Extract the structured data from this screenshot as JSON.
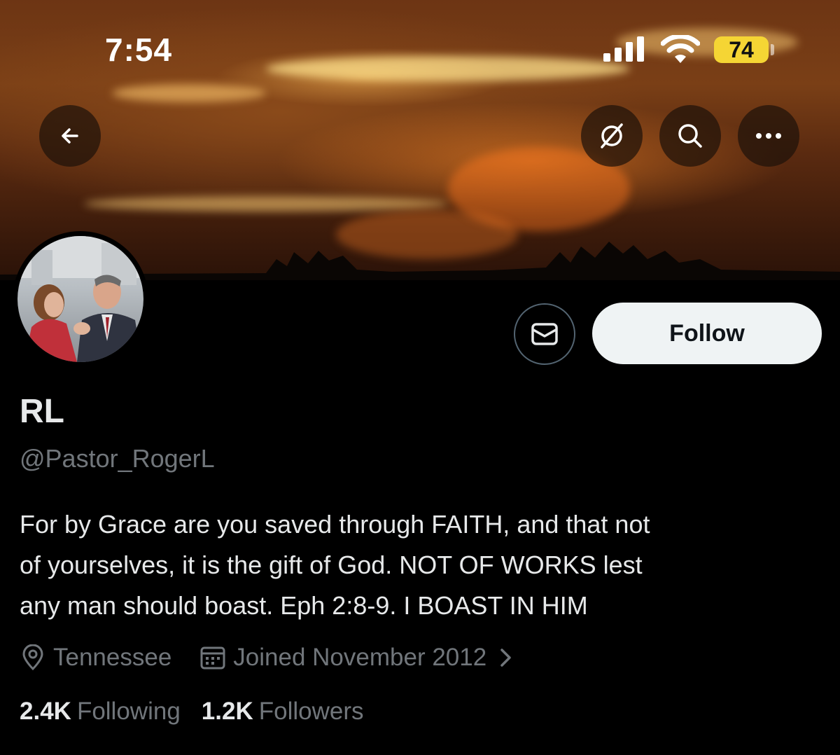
{
  "status_bar": {
    "time": "7:54",
    "battery": "74",
    "icons": [
      "cellular-signal-icon",
      "wifi-icon",
      "battery-icon"
    ]
  },
  "nav": {
    "icons": [
      "back-arrow-icon",
      "grok-icon",
      "search-icon",
      "more-icon"
    ]
  },
  "profile": {
    "display_name": "RL",
    "handle": "@Pastor_RogerL",
    "bio_lines": [
      "For by Grace are you saved through FAITH, and that not",
      "of yourselves, it is the gift of God. NOT OF WORKS lest",
      "any man should boast. Eph 2:8-9. I BOAST IN HIM"
    ],
    "location": "Tennessee",
    "joined": "Joined November 2012"
  },
  "actions": {
    "follow_label": "Follow",
    "message_icon": "envelope-icon"
  },
  "stats": {
    "following_count": "2.4K",
    "following_label": "Following",
    "followers_count": "1.2K",
    "followers_label": "Followers"
  },
  "colors": {
    "background": "#000000",
    "primary_text": "#e7e9ea",
    "secondary_text": "#71767b",
    "follow_button_bg": "#eff3f4",
    "battery_yellow": "#f5d534"
  }
}
